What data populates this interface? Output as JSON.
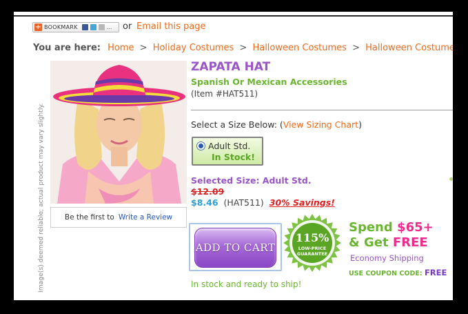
{
  "share": {
    "bookmark_label": "BOOKMARK",
    "bookmark_more": "...",
    "or_text": "or",
    "email_link": "Email this page"
  },
  "breadcrumb": {
    "prefix": "You are here:",
    "items": [
      "Home",
      "Holiday Costumes",
      "Halloween Costumes",
      "Halloween Costume A"
    ],
    "separator": ">"
  },
  "product": {
    "image_disclaimer": "Image(s) deemed reliable; actual product may vary slightly.",
    "name": "ZAPATA HAT",
    "category": "Spanish Or Mexican Accessories",
    "item_number": "(Item #HAT511)",
    "select_prompt": "Select a Size Below: (",
    "sizing_chart_link": "View Sizing Chart",
    "select_close": ")",
    "size_option": {
      "label": "Adult Std.",
      "status": "In Stock!",
      "selected": true
    },
    "selected_size_text": "Selected Size: Adult Std.",
    "old_price": "$12.09",
    "price": "$8.46",
    "price_code": "(HAT511)",
    "savings": "30% Savings!",
    "add_to_cart_label": "ADD TO CART",
    "stock_message": "In stock and ready to ship!"
  },
  "review": {
    "prompt": "Be the first to",
    "link": "Write a Review"
  },
  "guarantee_badge": {
    "percent": "115%",
    "line1": "LOW-PRICE",
    "line2": "GUARANTEE",
    "color": "#7dc242"
  },
  "promo": {
    "line1_text": "Spend",
    "line1_amount": "$65+",
    "line2_text": "& Get",
    "line2_accent": "FREE",
    "shipping": "Economy Shipping",
    "coupon_label": "USE COUPON CODE:",
    "coupon_code": "FREE"
  },
  "colors": {
    "accent_orange": "#ee6a1c",
    "title_purple": "#9a55c6",
    "green": "#6ab530",
    "sale_red": "#e01f1f",
    "price_blue": "#2aa0d9"
  }
}
